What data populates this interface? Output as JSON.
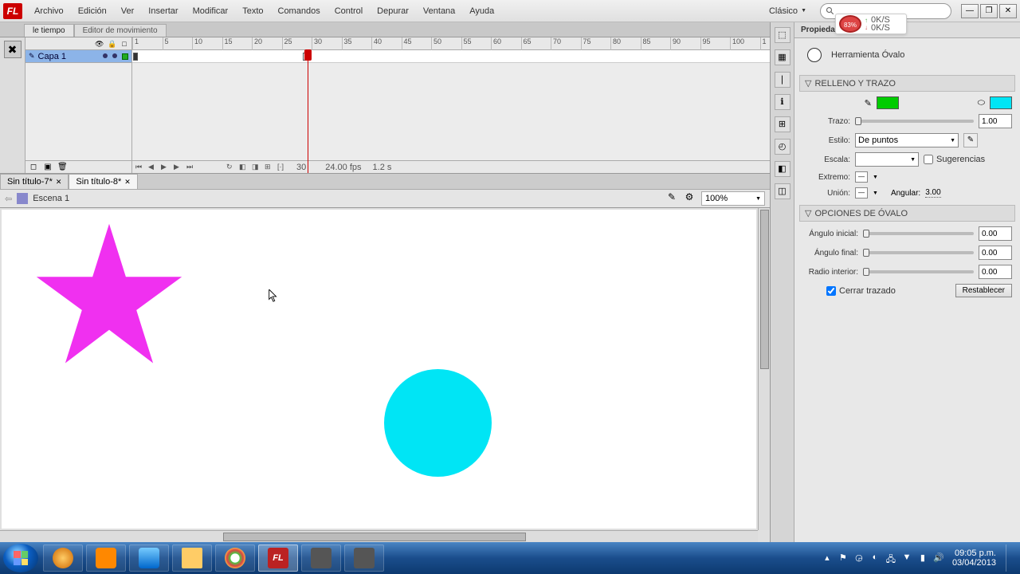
{
  "menu": [
    "Archivo",
    "Edición",
    "Ver",
    "Insertar",
    "Modificar",
    "Texto",
    "Comandos",
    "Control",
    "Depurar",
    "Ventana",
    "Ayuda"
  ],
  "workspace": "Clásico",
  "timeline": {
    "tabs": [
      "le tiempo",
      "Editor de movimiento"
    ],
    "layer": "Capa 1",
    "ticks": [
      "1",
      "5",
      "10",
      "15",
      "20",
      "25",
      "30",
      "35",
      "40",
      "45",
      "50",
      "55",
      "60",
      "65",
      "70",
      "75",
      "80",
      "85",
      "90",
      "95",
      "100",
      "1"
    ],
    "frame": "30",
    "fps": "24.00 fps",
    "time": "1.2 s"
  },
  "docs": [
    {
      "name": "Sin título-7*"
    },
    {
      "name": "Sin título-8*"
    }
  ],
  "scene": {
    "name": "Escena 1",
    "zoom": "100%"
  },
  "props": {
    "panel_title": "Propiedades",
    "tool": "Herramienta Óvalo",
    "sec_fill": "RELLENO Y TRAZO",
    "fill_color": "#00cc00",
    "stroke_color": "#00e5f5",
    "stroke": "Trazo:",
    "stroke_val": "1.00",
    "style": "Estilo:",
    "style_val": "De puntos",
    "scale": "Escala:",
    "scale_val": "",
    "hints": "Sugerencias",
    "cap": "Extremo:",
    "join": "Unión:",
    "miter": "Angular:",
    "miter_val": "3.00",
    "sec_oval": "OPCIONES DE ÓVALO",
    "start_angle": "Ángulo inicial:",
    "start_val": "0.00",
    "end_angle": "Ángulo final:",
    "end_val": "0.00",
    "inner": "Radio interior:",
    "inner_val": "0.00",
    "close": "Cerrar trazado",
    "reset": "Restablecer"
  },
  "net": {
    "pct": "83%",
    "up": "0K/S",
    "down": "0K/S"
  },
  "clock": {
    "time": "09:05 p.m.",
    "date": "03/04/2013"
  }
}
